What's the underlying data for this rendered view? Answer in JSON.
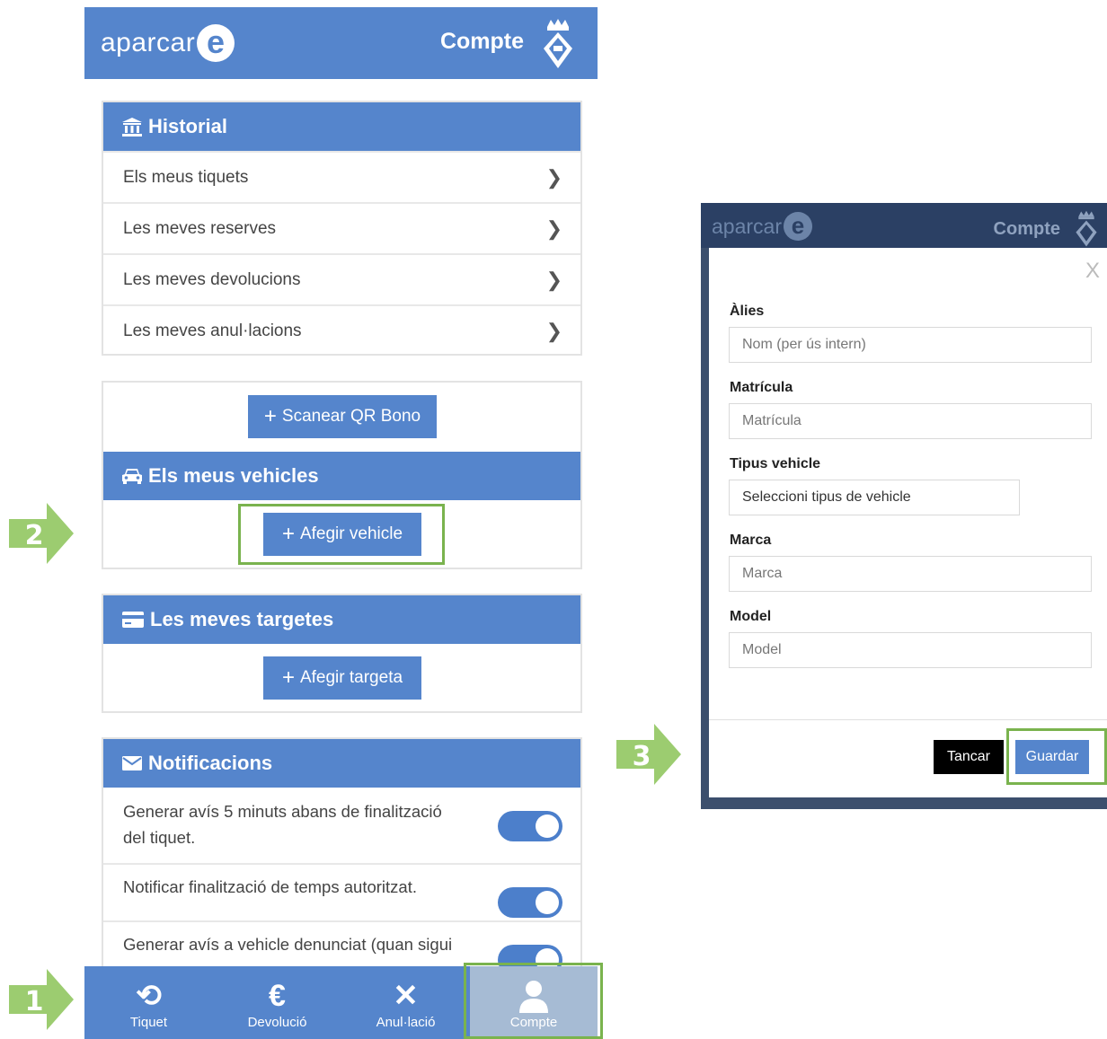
{
  "topbar": {
    "logo_text": "aparcar",
    "logo_mark": "e",
    "title": "Compte"
  },
  "historial": {
    "title": "Historial",
    "items": [
      {
        "label": "Els meus tiquets"
      },
      {
        "label": "Les meves reserves"
      },
      {
        "label": "Les meves devolucions"
      },
      {
        "label": "Les meves anul·lacions"
      }
    ]
  },
  "vehicles": {
    "scan_button": "Scanear QR Bono",
    "title": "Els meus vehicles",
    "add_button": "Afegir vehicle"
  },
  "cards": {
    "title": "Les meves targetes",
    "add_button": "Afegir targeta"
  },
  "notifications": {
    "title": "Notificacions",
    "items": [
      {
        "line1": "Generar avís 5 minuts abans de finalització",
        "line2": "del tiquet.",
        "enabled": true
      },
      {
        "line1": "Notificar finalització de temps autoritzat.",
        "line2": "",
        "enabled": true
      },
      {
        "line1": "Generar avís a vehicle denunciat (quan sigui",
        "line2": "",
        "enabled": true
      }
    ]
  },
  "bottom_nav": {
    "items": [
      {
        "label": "Tiquet",
        "icon": "history-icon"
      },
      {
        "label": "Devolució",
        "icon": "euro-icon"
      },
      {
        "label": "Anul·lació",
        "icon": "close-icon"
      },
      {
        "label": "Compte",
        "icon": "user-icon",
        "active": true
      }
    ]
  },
  "steps": {
    "one": "1",
    "two": "2",
    "three": "3"
  },
  "modal": {
    "header_logo_text": "aparcar",
    "header_title": "Compte",
    "close": "X",
    "alias_label": "Àlies",
    "alias_placeholder": "Nom (per ús intern)",
    "plate_label": "Matrícula",
    "plate_placeholder": "Matrícula",
    "type_label": "Tipus vehicle",
    "type_value": "Seleccioni tipus de vehicle",
    "brand_label": "Marca",
    "brand_placeholder": "Marca",
    "model_label": "Model",
    "model_placeholder": "Model",
    "cancel_button": "Tancar",
    "save_button": "Guardar"
  },
  "colors": {
    "primary": "#5585cc",
    "highlight": "#7ab34e",
    "arrow": "#9ccc70"
  }
}
